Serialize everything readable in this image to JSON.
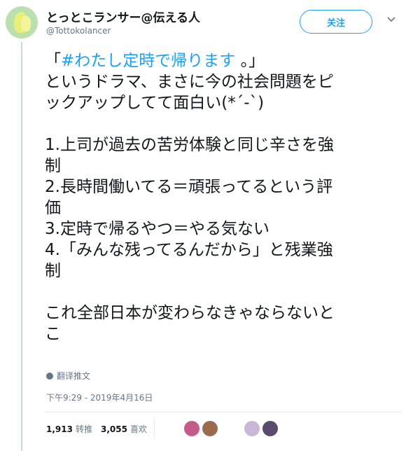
{
  "user": {
    "display_name": "とっとこランサー@伝える人",
    "handle": "@Tottokolancer"
  },
  "follow_button": {
    "label": "关注"
  },
  "tweet": {
    "lines": [
      {
        "pre": "「",
        "tag": "#わたし定時で帰ります",
        "post": " 。」"
      },
      {
        "text": "というドラマ、まさに今の社会問題をピ"
      },
      {
        "text": "ックアップしてて面白い(*´-`)"
      },
      {
        "blank": true
      },
      {
        "text": "1.上司が過去の苦労体験と同じ辛さを強"
      },
      {
        "text": "制"
      },
      {
        "text": "2.長時間働いてる＝頑張ってるという評"
      },
      {
        "text": "価"
      },
      {
        "text": "3.定時で帰るやつ＝やる気ない"
      },
      {
        "text": "4.「みんな残ってるんだから」と残業強"
      },
      {
        "text": "制"
      },
      {
        "blank": true
      },
      {
        "text": "これ全部日本が変わらなきゃならないと"
      },
      {
        "text": "こ"
      }
    ],
    "translate_label": "翻译推文",
    "timestamp": "下午9:29 - 2019年4月16日"
  },
  "stats": {
    "retweets_count": "1,913",
    "retweets_label": "转推",
    "likes_count": "3,055",
    "likes_label": "喜欢"
  },
  "colors": {
    "accent": "#1da1f2",
    "secondary_text": "#657786",
    "border": "#e6ecf0"
  },
  "likers": [
    {
      "color": "#c45b8a"
    },
    {
      "color": "#9a6b4f"
    },
    {
      "color": "#c9b6d8"
    },
    {
      "color": "#5a4a6e"
    }
  ]
}
